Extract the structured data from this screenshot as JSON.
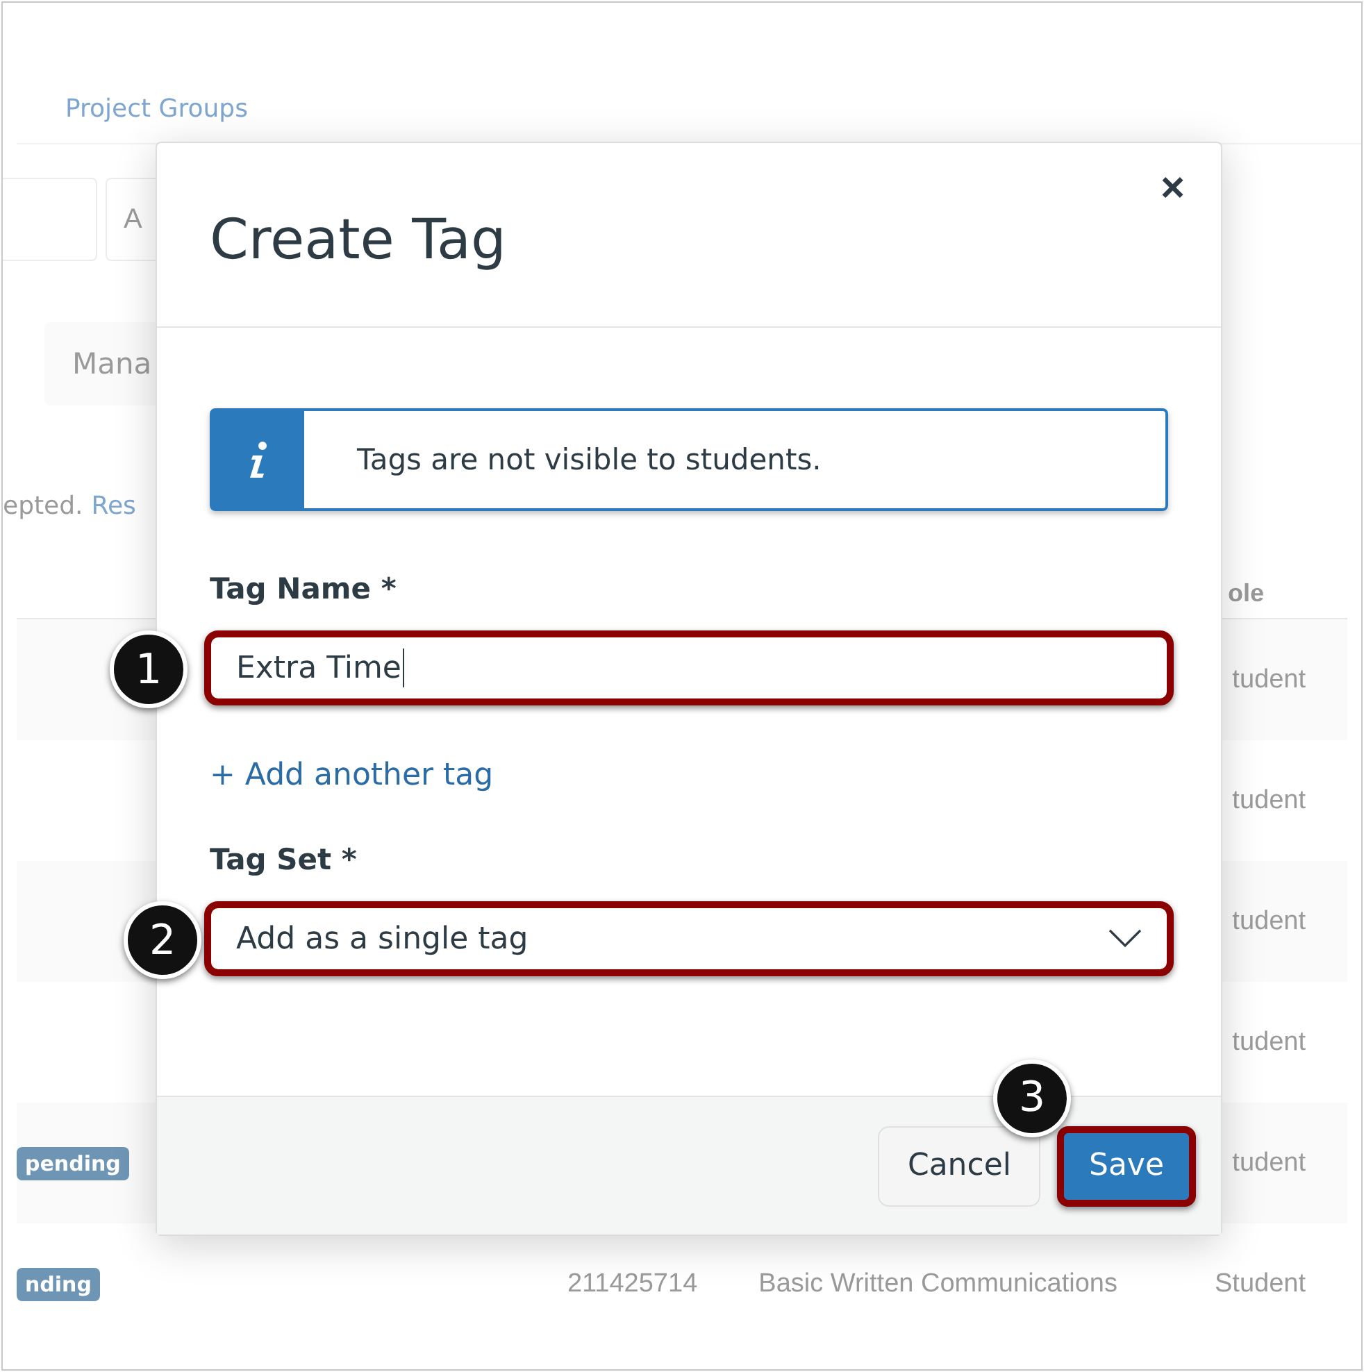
{
  "background": {
    "tabs": [
      {
        "label": "Project Groups"
      }
    ],
    "toolbar": {
      "field_2_text": "A",
      "button_text": "Mana"
    },
    "notice": {
      "text": "epted.",
      "link": "Res"
    },
    "table": {
      "column_header": "ole",
      "rows": [
        {
          "badge": "",
          "id": "",
          "section": "",
          "role": "tudent"
        },
        {
          "badge": "",
          "id": "",
          "section": "",
          "role": "tudent"
        },
        {
          "badge": "",
          "id": "",
          "section": "",
          "role": "tudent"
        },
        {
          "badge": "",
          "id": "",
          "section": "",
          "role": "tudent"
        },
        {
          "badge": "pending",
          "id": "",
          "section": "",
          "role": "tudent"
        },
        {
          "badge": "nding",
          "id": "211425714",
          "section": "Basic Written Communications",
          "role": "Student"
        }
      ]
    }
  },
  "dialog": {
    "title": "Create Tag",
    "close": "×",
    "info": "Tags are not visible to students.",
    "tag_name": {
      "label": "Tag Name *",
      "value": "Extra Time",
      "highlighted": true,
      "step": "1"
    },
    "add_link": "+ Add another tag",
    "tag_set": {
      "label": "Tag Set *",
      "value": "Add as a single tag",
      "highlighted": true,
      "step": "2"
    },
    "buttons": [
      {
        "label": "Cancel",
        "kind": "secondary",
        "highlighted": false
      },
      {
        "label": "Save",
        "kind": "primary",
        "highlighted": true,
        "step": "3"
      }
    ]
  }
}
